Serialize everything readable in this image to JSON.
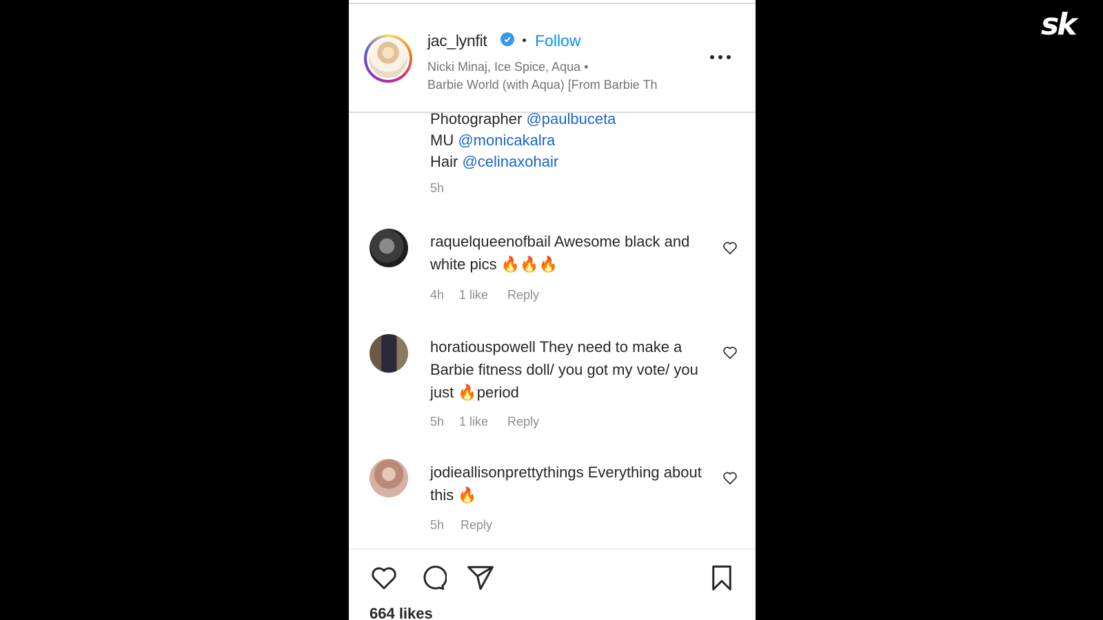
{
  "brand": {
    "logo_text": "sk"
  },
  "post": {
    "header": {
      "username": "jac_lynfit",
      "separator": "•",
      "follow_label": "Follow",
      "music_line1": "Nicki Minaj, Ice Spice, Aqua •",
      "music_line2": "Barbie World (with Aqua) [From Barbie Th"
    },
    "caption": {
      "lines": [
        {
          "label": "Photographer ",
          "mention": "@paulbuceta"
        },
        {
          "label": "MU ",
          "mention": "@monicakalra"
        },
        {
          "label": "Hair ",
          "mention": "@celinaxohair"
        }
      ],
      "time": "5h"
    },
    "comments": [
      {
        "username": "raquelqueenofbail",
        "text": "Awesome black and white pics 🔥🔥🔥",
        "time": "4h",
        "likes": "1 like",
        "reply_label": "Reply"
      },
      {
        "username": "horatiouspowell",
        "text": "They need to make a Barbie fitness doll/ you got my vote/ you just 🔥period",
        "time": "5h",
        "likes": "1 like",
        "reply_label": "Reply"
      },
      {
        "username": "jodieallisonprettythings",
        "text": "Everything about this 🔥",
        "time": "5h",
        "reply_label": "Reply"
      }
    ],
    "likes_count": "664 likes"
  },
  "colors": {
    "follow": "#0095f6",
    "mention": "#1a66c9",
    "verified": "#3897f0",
    "meta": "#8e8e8e"
  },
  "icons": {
    "verified": "verified-badge-icon",
    "more": "more-options-icon",
    "comment_like": "heart-outline-icon",
    "like": "heart-icon",
    "comment": "comment-bubble-icon",
    "share": "paper-plane-icon",
    "save": "bookmark-icon"
  }
}
